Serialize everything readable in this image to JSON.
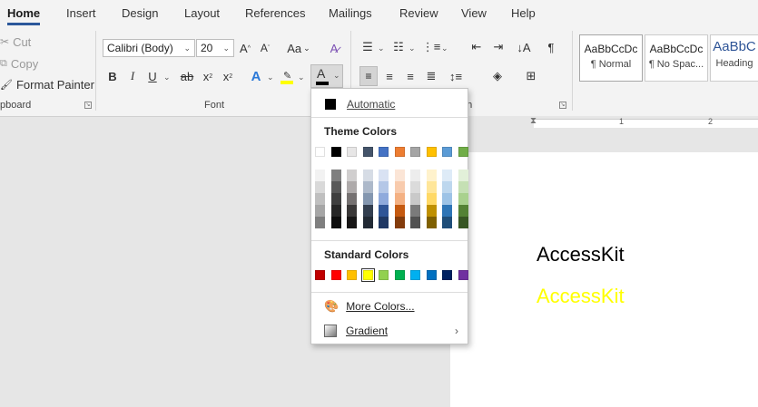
{
  "tabs": [
    "Home",
    "Insert",
    "Design",
    "Layout",
    "References",
    "Mailings",
    "Review",
    "View",
    "Help"
  ],
  "clipboard": {
    "cut": "Cut",
    "copy": "Copy",
    "format_painter": "Format Painter",
    "label": "pboard"
  },
  "font": {
    "name": "Calibri (Body)",
    "size": "20",
    "label": "Font",
    "change_case": "Aa",
    "bold": "B",
    "italic": "I",
    "underline": "U",
    "strike": "ab",
    "subscript": "x",
    "superscript": "x",
    "font_color_letter": "A"
  },
  "paragraph": {
    "label": "ph"
  },
  "styles": [
    {
      "sample": "AaBbCcDc",
      "name": "¶ Normal"
    },
    {
      "sample": "AaBbCcDc",
      "name": "¶ No Spac..."
    },
    {
      "sample": "AaBbC",
      "name": "Heading"
    }
  ],
  "ruler": {
    "marks": [
      "1",
      "2"
    ]
  },
  "document": {
    "line1": "AccessKit",
    "line2": "AccessKit",
    "line1_color": "#000000",
    "line2_color": "#ffff00"
  },
  "color_menu": {
    "automatic": "Automatic",
    "theme_heading": "Theme Colors",
    "theme_base": [
      "#ffffff",
      "#000000",
      "#e7e6e6",
      "#44546a",
      "#4472c4",
      "#ed7d31",
      "#a5a5a5",
      "#ffc000",
      "#5b9bd5",
      "#70ad47"
    ],
    "theme_shades": [
      [
        "#f2f2f2",
        "#d9d9d9",
        "#bfbfbf",
        "#a6a6a6",
        "#7f7f7f"
      ],
      [
        "#7f7f7f",
        "#595959",
        "#3f3f3f",
        "#262626",
        "#0d0d0d"
      ],
      [
        "#d0cece",
        "#aeaaaa",
        "#757171",
        "#3a3838",
        "#171616"
      ],
      [
        "#d6dce5",
        "#adb9ca",
        "#8497b0",
        "#333f50",
        "#222a35"
      ],
      [
        "#d9e2f3",
        "#b4c7e7",
        "#8faadc",
        "#2f5597",
        "#1f3864"
      ],
      [
        "#fbe5d6",
        "#f8cbad",
        "#f4b183",
        "#c55a11",
        "#843c0c"
      ],
      [
        "#ededed",
        "#dbdbdb",
        "#c9c9c9",
        "#7b7b7b",
        "#525252"
      ],
      [
        "#fff2cc",
        "#ffe699",
        "#ffd966",
        "#bf9000",
        "#7f6000"
      ],
      [
        "#deebf7",
        "#bdd7ee",
        "#9dc3e6",
        "#2e75b6",
        "#1f4e79"
      ],
      [
        "#e2f0d9",
        "#c5e0b4",
        "#a9d18e",
        "#548235",
        "#375623"
      ]
    ],
    "standard_heading": "Standard Colors",
    "standard": [
      "#c00000",
      "#ff0000",
      "#ffc000",
      "#ffff00",
      "#92d050",
      "#00b050",
      "#00b0f0",
      "#0070c0",
      "#002060",
      "#7030a0"
    ],
    "selected_standard_index": 3,
    "more_colors": "More Colors...",
    "gradient": "Gradient"
  }
}
